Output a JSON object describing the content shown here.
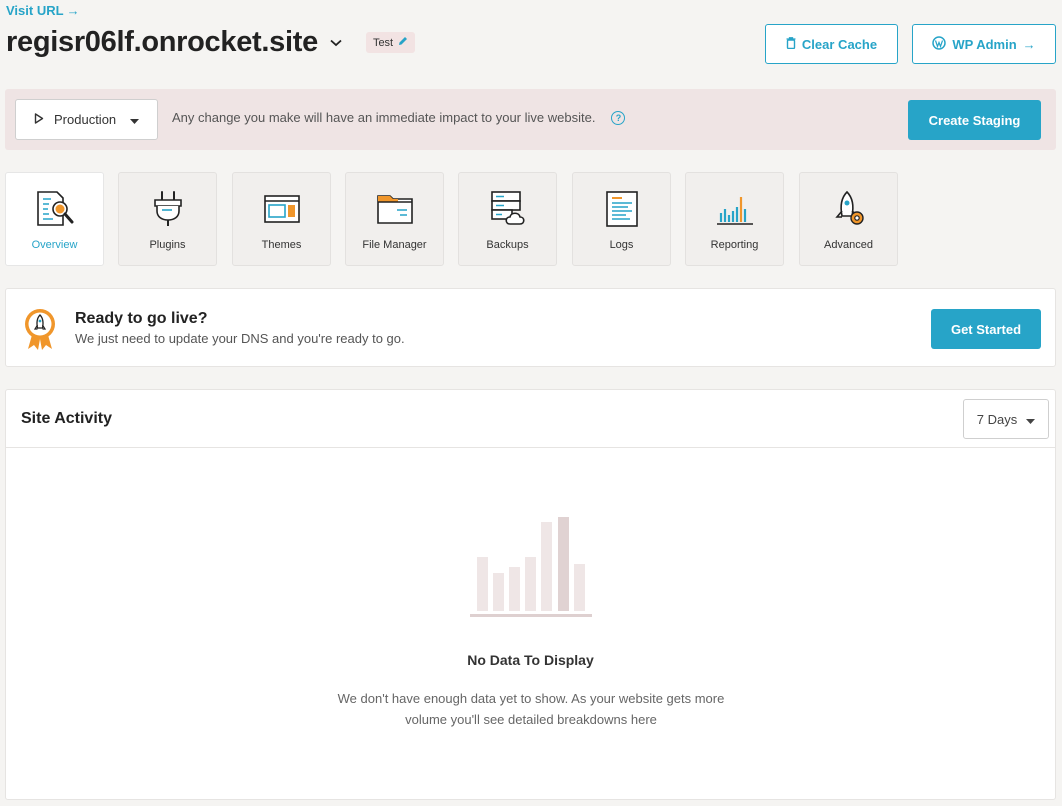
{
  "header": {
    "visit_url": "Visit URL",
    "site_title": "regisr06lf.onrocket.site",
    "env_badge": "Test",
    "clear_cache": "Clear Cache",
    "wp_admin": "WP Admin"
  },
  "environment": {
    "selected": "Production",
    "warning": "Any change you make will have an immediate impact to your live website.",
    "create_staging": "Create Staging"
  },
  "nav": {
    "tabs": [
      {
        "label": "Overview",
        "icon": "overview-icon",
        "active": true
      },
      {
        "label": "Plugins",
        "icon": "plugin-icon"
      },
      {
        "label": "Themes",
        "icon": "themes-icon"
      },
      {
        "label": "File Manager",
        "icon": "folder-icon"
      },
      {
        "label": "Backups",
        "icon": "backup-icon"
      },
      {
        "label": "Logs",
        "icon": "logs-icon"
      },
      {
        "label": "Reporting",
        "icon": "reporting-icon"
      },
      {
        "label": "Advanced",
        "icon": "advanced-icon"
      }
    ]
  },
  "golive": {
    "title": "Ready to go live?",
    "subtitle": "We just need to update your DNS and you're ready to go.",
    "button": "Get Started"
  },
  "activity": {
    "title": "Site Activity",
    "range": "7 Days",
    "empty_title": "No Data To Display",
    "empty_desc_line1": "We don't have enough data yet to show. As your website gets more",
    "empty_desc_line2": "volume you'll see detailed breakdowns here"
  },
  "colors": {
    "accent": "#27a4c8",
    "orange": "#f0962b",
    "env_bar": "#efe4e4",
    "background": "#f5f4f2"
  }
}
